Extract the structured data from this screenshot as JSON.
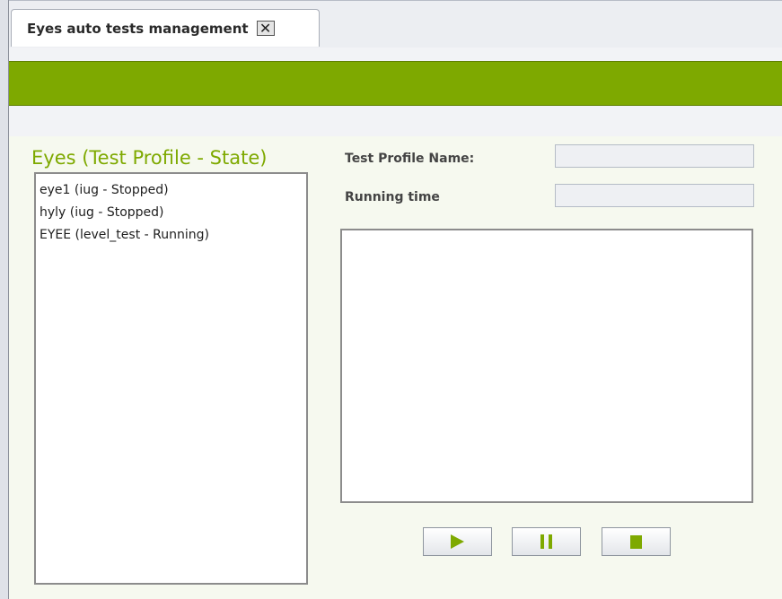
{
  "tab": {
    "title": "Eyes auto tests management",
    "close_glyph": "✕"
  },
  "list": {
    "title": "Eyes (Test Profile - State)",
    "items": [
      {
        "label": "eye1 (iug - Stopped)"
      },
      {
        "label": "hyly (iug - Stopped)"
      },
      {
        "label": "EYEE (level_test - Running)"
      }
    ]
  },
  "details": {
    "profile_name_label": "Test Profile Name:",
    "profile_name_value": "",
    "running_time_label": "Running time",
    "running_time_value": "",
    "log": ""
  },
  "controls": {
    "play_icon": "play-icon",
    "pause_icon": "pause-icon",
    "stop_icon": "stop-icon"
  },
  "colors": {
    "accent_green": "#7ea900",
    "content_background": "#f6f9ef",
    "tab_bar_background": "#eceef2"
  }
}
